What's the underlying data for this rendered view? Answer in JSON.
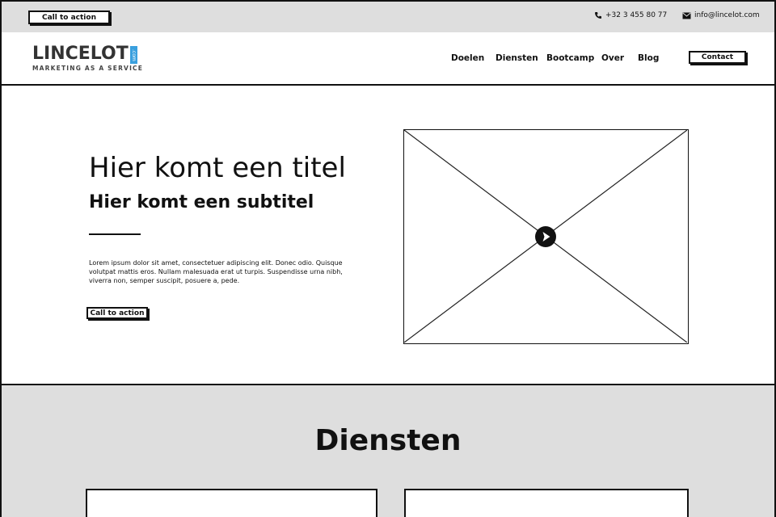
{
  "topbar": {
    "cta_label": "Call to action",
    "phone": "+32 3 455 80 77",
    "email": "info@lincelot.com",
    "phone_icon": "phone-icon",
    "email_icon": "envelope-icon"
  },
  "header": {
    "logo_text": "LINCELOT",
    "logo_com": ".com",
    "logo_tagline": "MARKETING AS A SERVICE",
    "nav": [
      "Doelen",
      "Diensten",
      "Bootcamp",
      "Over",
      "Blog"
    ],
    "contact_label": "Contact"
  },
  "hero": {
    "title": "Hier komt een titel",
    "subtitle": "Hier komt een subtitel",
    "body": "Lorem ipsum dolor sit amet, consectetuer adipiscing elit. Donec odio. Quisque volutpat mattis eros. Nullam malesuada erat ut turpis. Suspendisse urna nibh, viverra non, semper suscipit, posuere a, pede.",
    "cta_label": "Call to action",
    "video_icon": "play-icon"
  },
  "services": {
    "title": "Diensten"
  },
  "colors": {
    "band_gray": "#dedede",
    "ink": "#111111",
    "logo_accent": "#3aa0de"
  }
}
